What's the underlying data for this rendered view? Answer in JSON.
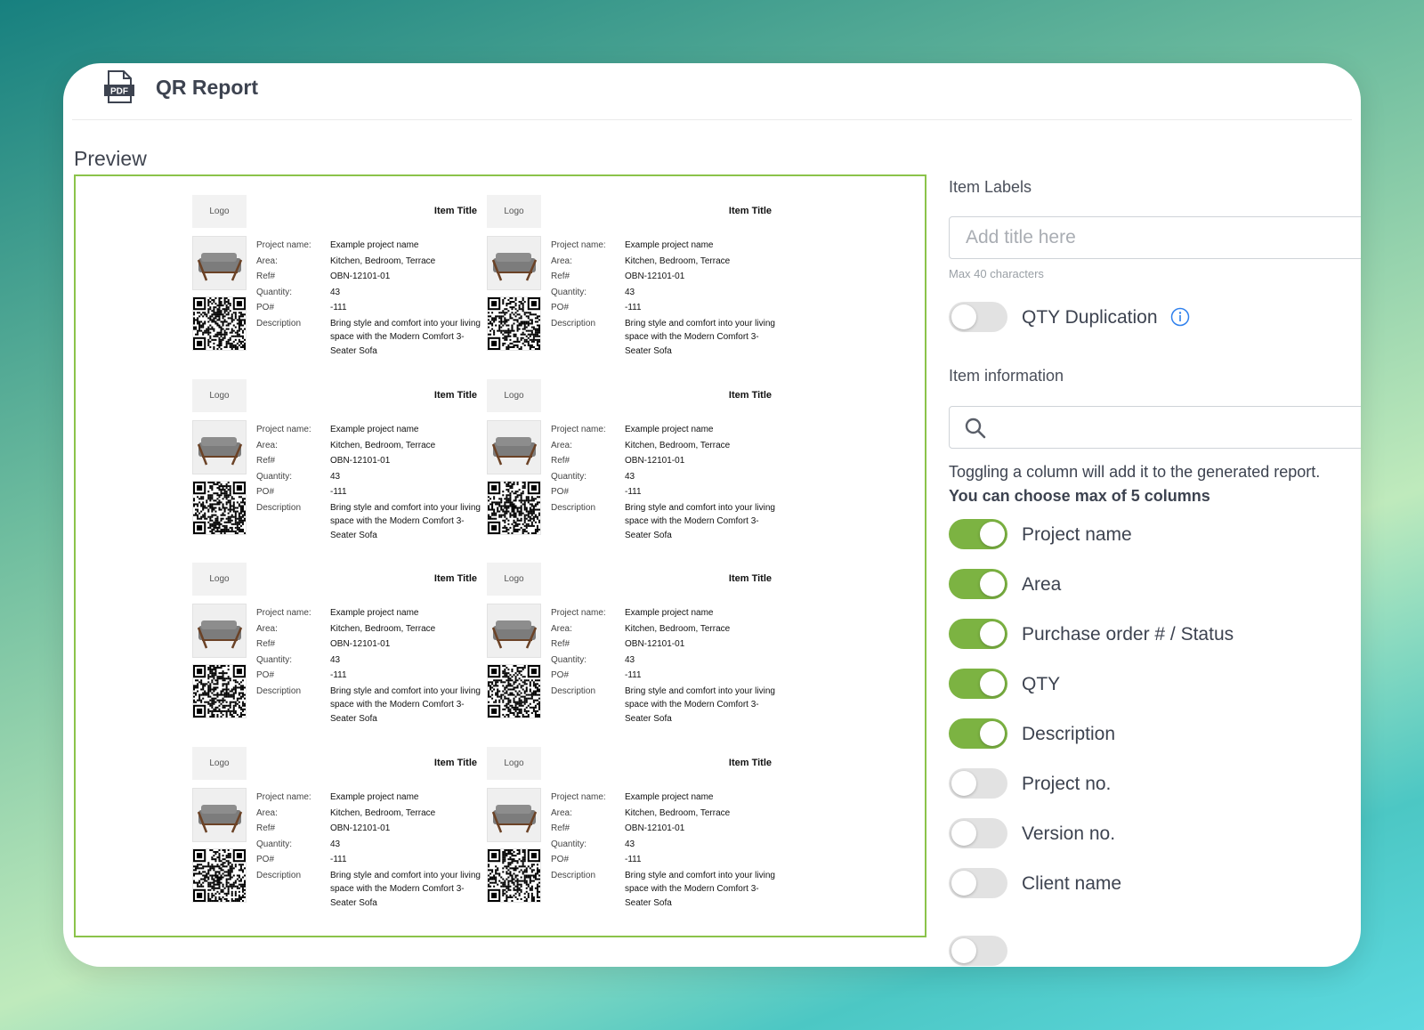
{
  "app": {
    "title": "QR Report",
    "icon": "pdf-file-icon",
    "icon_text": "PDF"
  },
  "preview": {
    "title": "Preview",
    "card": {
      "logo": "Logo",
      "item_title": "Item Title",
      "labels": [
        "Project name:",
        "Area:",
        "Ref#",
        "Quantity:",
        "PO#",
        "Description"
      ],
      "values": [
        "Example project name",
        "Kitchen, Bedroom, Terrace",
        "OBN-12101-01",
        "43",
        "-111"
      ],
      "description": "Bring style and comfort into your living space with the Modern Comfort 3-Seater Sofa"
    }
  },
  "settings": {
    "item_labels": {
      "title": "Item Labels",
      "placeholder": "Add title here",
      "helper": "Max 40 characters"
    },
    "qty_duplication": {
      "label": "QTY Duplication",
      "on": false,
      "icon": "info-icon"
    },
    "item_information": {
      "title": "Item information",
      "search_icon": "search-icon",
      "hint": "Toggling a column will add it to the generated report.",
      "hint_bold": "You can choose max of 5 columns"
    },
    "columns": [
      {
        "label": "Project name",
        "on": true
      },
      {
        "label": "Area",
        "on": true
      },
      {
        "label": "Purchase order # / Status",
        "on": true
      },
      {
        "label": "QTY",
        "on": true
      },
      {
        "label": "Description",
        "on": true
      },
      {
        "label": "Project no.",
        "on": false
      },
      {
        "label": "Version no.",
        "on": false
      },
      {
        "label": "Client name",
        "on": false
      }
    ],
    "colors": {
      "toggle_on": "#7cb342",
      "toggle_off": "#e2e2e2",
      "preview_border": "#8bc34a",
      "info": "#2f80ed"
    }
  }
}
